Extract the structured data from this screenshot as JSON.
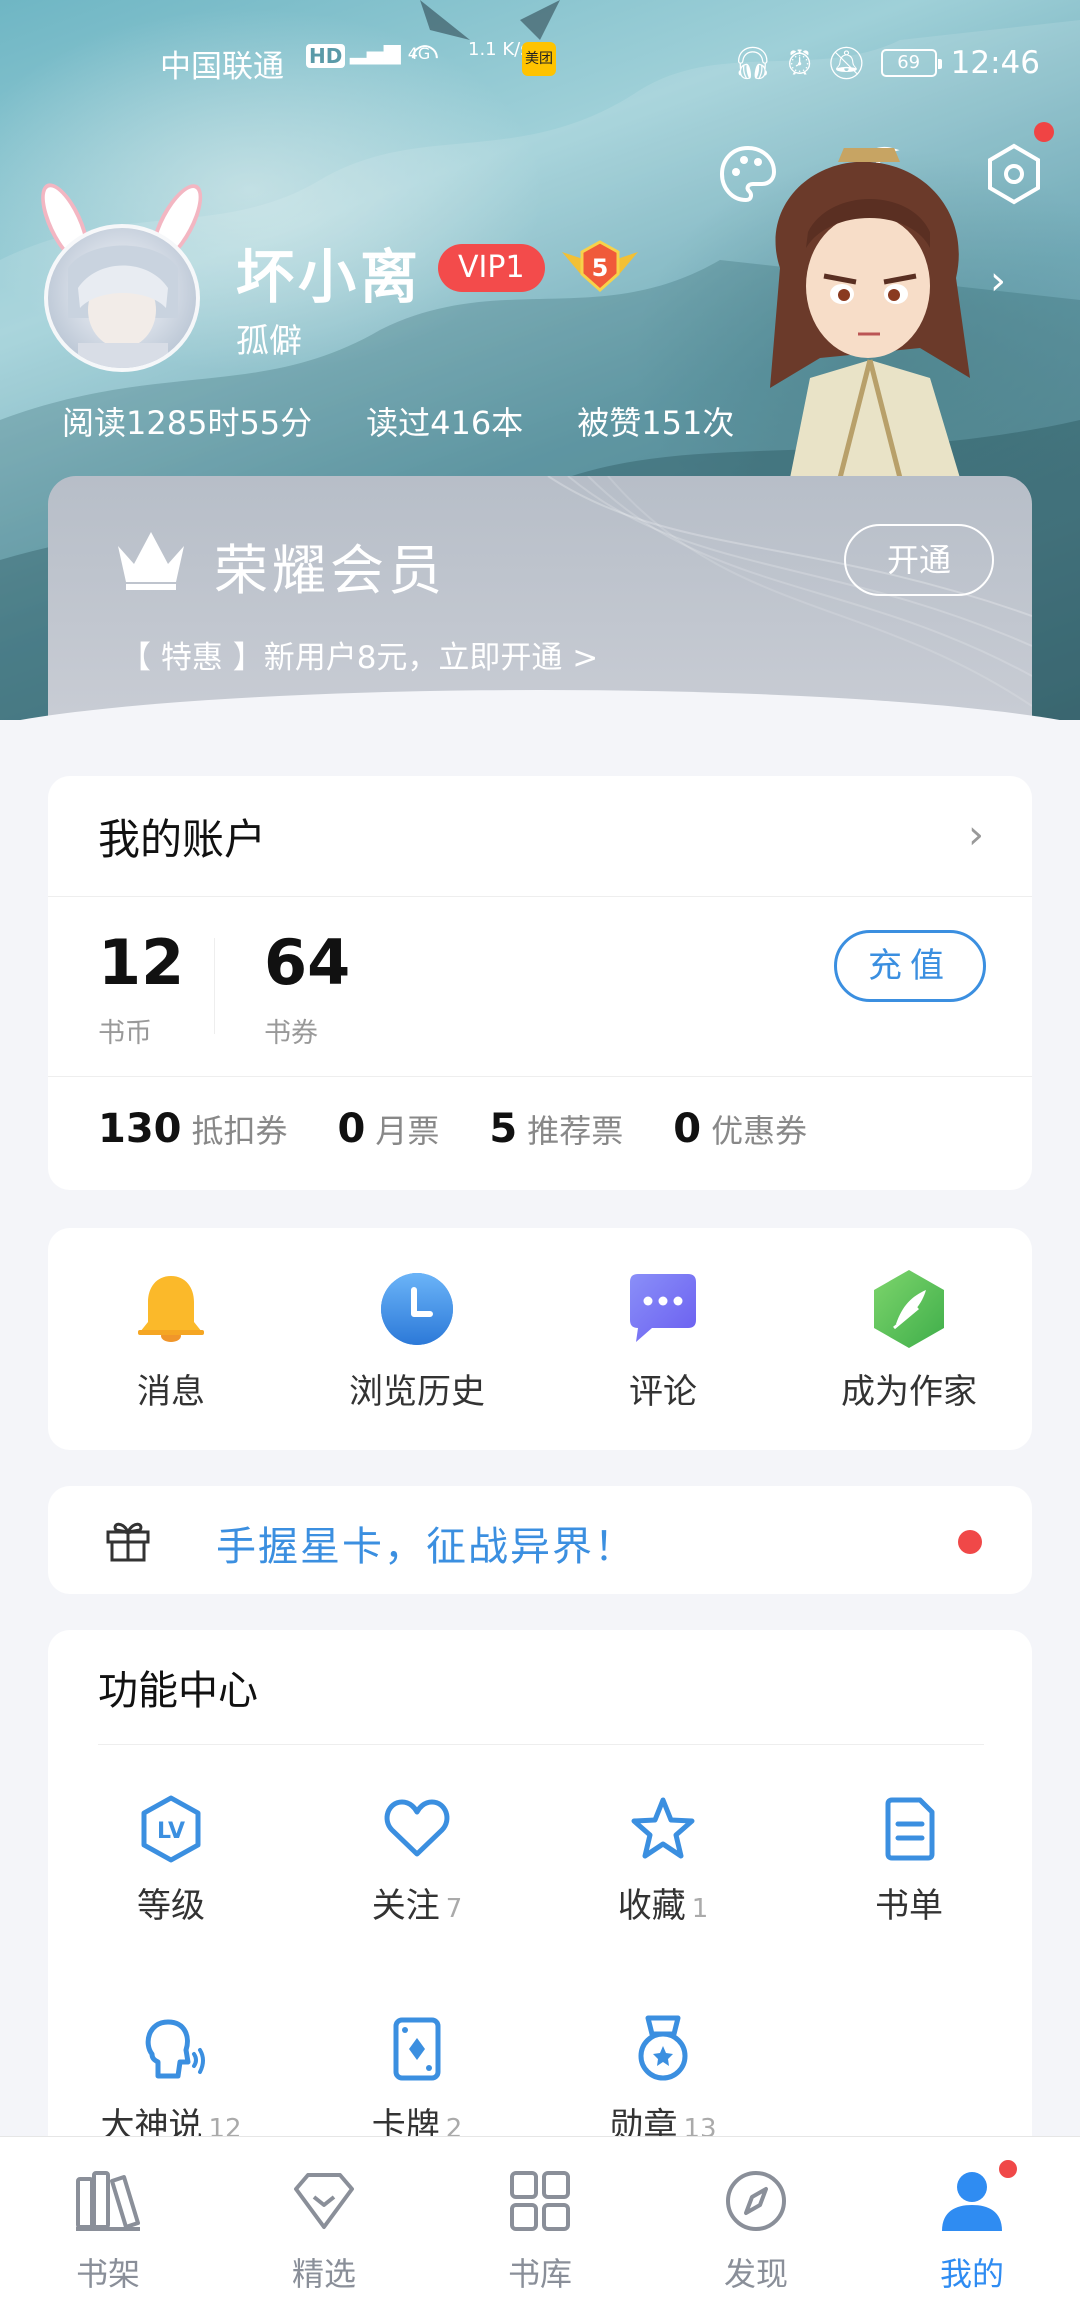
{
  "status_bar": {
    "carrier": "中国联通",
    "hd": "HD",
    "signal": "4G",
    "speed": "1.1 K/s",
    "app_badge": "美团",
    "battery": "69",
    "time": "12:46"
  },
  "profile": {
    "username": "坏小离",
    "vip_level": "VIP1",
    "user_level": "5",
    "signature": "孤僻",
    "stats": [
      {
        "label": "阅读1285时55分"
      },
      {
        "label": "读过416本"
      },
      {
        "label": "被赞151次"
      }
    ]
  },
  "membership": {
    "title": "荣耀会员",
    "open_button": "开通",
    "promo": "【 特惠 】新用户8元，立即开通 >"
  },
  "account": {
    "title": "我的账户",
    "balances": [
      {
        "value": "12",
        "label": "书币"
      },
      {
        "value": "64",
        "label": "书券"
      }
    ],
    "recharge_button": "充值",
    "tickets": [
      {
        "value": "130",
        "label": "抵扣券"
      },
      {
        "value": "0",
        "label": "月票"
      },
      {
        "value": "5",
        "label": "推荐票"
      },
      {
        "value": "0",
        "label": "优惠券"
      }
    ]
  },
  "quick_actions": [
    {
      "label": "消息",
      "icon": "bell-icon"
    },
    {
      "label": "浏览历史",
      "icon": "clock-icon"
    },
    {
      "label": "评论",
      "icon": "chat-icon"
    },
    {
      "label": "成为作家",
      "icon": "quill-icon"
    }
  ],
  "promo_banner": {
    "text": "手握星卡，征战异界！"
  },
  "function_center": {
    "title": "功能中心",
    "items": [
      {
        "label": "等级",
        "count": "",
        "icon": "level-icon"
      },
      {
        "label": "关注",
        "count": "7",
        "icon": "heart-icon"
      },
      {
        "label": "收藏",
        "count": "1",
        "icon": "star-icon"
      },
      {
        "label": "书单",
        "count": "",
        "icon": "booklist-icon"
      },
      {
        "label": "大神说",
        "count": "12",
        "icon": "speaker-icon"
      },
      {
        "label": "卡牌",
        "count": "2",
        "icon": "card-icon"
      },
      {
        "label": "勋章",
        "count": "13",
        "icon": "medal-icon"
      }
    ]
  },
  "tab_bar": [
    {
      "label": "书架",
      "icon": "bookshelf-icon"
    },
    {
      "label": "精选",
      "icon": "diamond-icon"
    },
    {
      "label": "书库",
      "icon": "grid-icon"
    },
    {
      "label": "发现",
      "icon": "compass-icon"
    },
    {
      "label": "我的",
      "icon": "user-icon",
      "active": true
    }
  ],
  "colors": {
    "accent_blue": "#3b8fe0",
    "tab_active": "#2f8cf2",
    "vip_red": "#f34b4b",
    "notification_red": "#f04848",
    "page_bg": "#f4f5f9"
  }
}
